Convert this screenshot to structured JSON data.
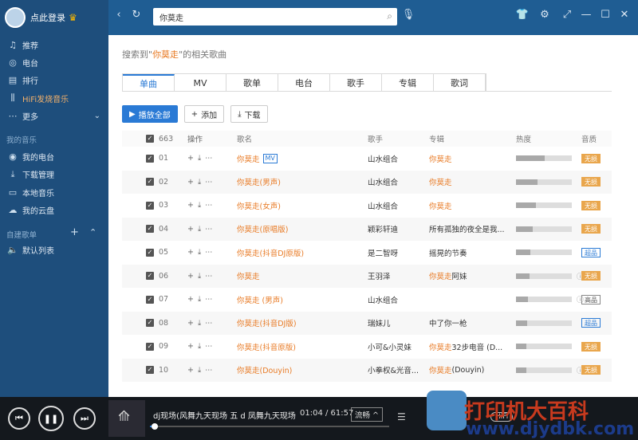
{
  "sidebar": {
    "login_label": "点此登录",
    "nav": [
      {
        "label": "推荐",
        "icon": "music-note-icon"
      },
      {
        "label": "电台",
        "icon": "radio-icon"
      },
      {
        "label": "排行",
        "icon": "chart-icon"
      },
      {
        "label": "HiFi发烧音乐",
        "icon": "waveform-icon"
      },
      {
        "label": "更多",
        "icon": "more-icon"
      }
    ],
    "my_music_title": "我的音乐",
    "my_music": [
      {
        "label": "我的电台",
        "icon": "user-radio-icon"
      },
      {
        "label": "下载管理",
        "icon": "download-icon"
      },
      {
        "label": "本地音乐",
        "icon": "monitor-icon"
      },
      {
        "label": "我的云盘",
        "icon": "cloud-icon"
      }
    ],
    "playlist_title": "自建歌单",
    "playlists": [
      {
        "label": "默认列表",
        "icon": "speaker-icon"
      }
    ]
  },
  "search": {
    "value": "你莫走"
  },
  "result": {
    "prefix": "搜索到\"",
    "keyword": "你莫走",
    "suffix": "\"的相关歌曲"
  },
  "tabs": [
    "单曲",
    "MV",
    "歌单",
    "电台",
    "歌手",
    "专辑",
    "歌词"
  ],
  "actions": {
    "play_all": "播放全部",
    "add": "添加",
    "download": "下载"
  },
  "table": {
    "count": "663",
    "headers": {
      "op": "操作",
      "song": "歌名",
      "artist": "歌手",
      "album": "专辑",
      "heat": "热度",
      "quality": "音质"
    },
    "rows": [
      {
        "num": "01",
        "song": "你莫走",
        "mv": "MV",
        "artist": "山水组合",
        "album": "你莫走",
        "album_hl": true,
        "heat": 0.52,
        "quality": "无损",
        "qtype": "loss"
      },
      {
        "num": "02",
        "song": "你莫走(男声)",
        "artist": "山水组合",
        "album": "你莫走",
        "album_hl": true,
        "heat": 0.38,
        "quality": "无损",
        "qtype": "loss"
      },
      {
        "num": "03",
        "song": "你莫走(女声)",
        "artist": "山水组合",
        "album": "你莫走",
        "album_hl": true,
        "heat": 0.36,
        "quality": "无损",
        "qtype": "loss"
      },
      {
        "num": "04",
        "song": "你莫走(原唱版)",
        "artist": "颖彩轩迪",
        "album": "所有孤独的夜全是我...",
        "album_hl": false,
        "heat": 0.3,
        "quality": "无损",
        "qtype": "loss"
      },
      {
        "num": "05",
        "song": "你莫走(抖音DJ原版)",
        "artist": "是二智呀",
        "album": "摇晃的节奏",
        "album_hl": false,
        "heat": 0.26,
        "quality": "超品",
        "qtype": "super"
      },
      {
        "num": "06",
        "song": "你莫走",
        "artist": "王羽泽",
        "album_pre": "你莫走",
        "album": "阿妹",
        "album_hl": true,
        "heat": 0.24,
        "quality": "无损",
        "qtype": "loss",
        "info": true
      },
      {
        "num": "07",
        "song": "你莫走 (男声)",
        "artist": "山水组合",
        "album": "",
        "album_hl": false,
        "heat": 0.22,
        "quality": "高品",
        "qtype": "hi",
        "info": true
      },
      {
        "num": "08",
        "song": "你莫走(抖音DJ版)",
        "artist": "瑞妹儿",
        "album": "中了你一枪",
        "album_hl": false,
        "heat": 0.2,
        "quality": "超品",
        "qtype": "super"
      },
      {
        "num": "09",
        "song": "你莫走(抖音原版)",
        "artist": "小可&小灵妹",
        "album_pre": "你莫走",
        "album": "32步电音 (D...",
        "album_hl": true,
        "heat": 0.19,
        "quality": "无损",
        "qtype": "loss"
      },
      {
        "num": "10",
        "song": "你莫走(Douyin)",
        "artist": "小拳权&光音...",
        "album_pre": "你莫走",
        "album": " (Douyin)",
        "album_hl": true,
        "heat": 0.18,
        "quality": "无损",
        "qtype": "loss",
        "info": true
      }
    ]
  },
  "player": {
    "title": "dj现场(风舞九天现场 五 d 凤舞九天现场",
    "time": "01:04 / 61:57",
    "fluency": "流畅 ^",
    "progress": 0.02,
    "hifi": "HiFi"
  },
  "watermark": {
    "line1": "打印机大百科",
    "line2": "www.djydbk.com"
  }
}
